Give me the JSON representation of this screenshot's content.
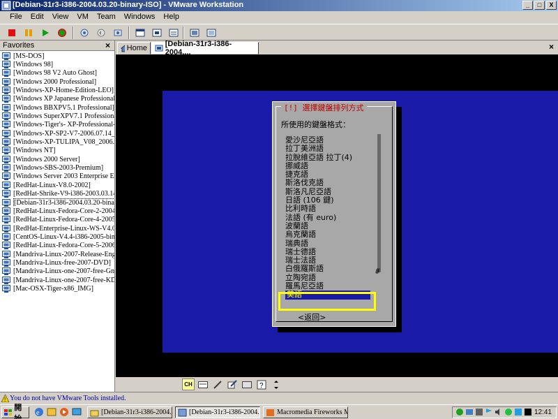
{
  "window": {
    "title": "[Debian-31r3-i386-2004.03.20-binary-ISO] - VMware Workstation",
    "buttons": [
      "_",
      "□",
      "X"
    ]
  },
  "menu": [
    {
      "label": "File",
      "accel": "F"
    },
    {
      "label": "Edit",
      "accel": "E"
    },
    {
      "label": "View",
      "accel": "V"
    },
    {
      "label": "VM",
      "accel": "M"
    },
    {
      "label": "Team",
      "accel": "T"
    },
    {
      "label": "Windows",
      "accel": "W"
    },
    {
      "label": "Help",
      "accel": "H"
    }
  ],
  "toolbar": {
    "icons": [
      "power-off-icon",
      "suspend-icon",
      "power-on-icon",
      "reset-icon",
      "snapshot-take-icon",
      "snapshot-revert-icon",
      "snapshot-manager-icon",
      "quick-switch-icon",
      "full-screen-icon",
      "summary-view-icon",
      "console-view-icon"
    ]
  },
  "favorites": {
    "header": "Favorites",
    "items": [
      "[MS-DOS]",
      "[Windows 98]",
      "[Windows 98 V2 Auto Ghost]",
      "[Windows 2000 Professional]",
      "[Windows-XP-Home-Edition-LEO]",
      "[Windows XP Japanese Professional]",
      "[Windows BBXPV5.1 Professional]",
      "[Windows SuperXPV7.1 Professional]",
      "[Windows-Tiger's- XP-Professional-20",
      "[Windows-XP-SP2-V7-2006.07.14_IS",
      "[Windows-XP-TULIPA_V08_2006.08",
      "[Windows NT]",
      "[Windows 2000 Server]",
      "[Windows-SBS-2003-Premium]",
      "[Windows Server 2003 Enterprise Edit",
      "[RedHat-Linux-V8.0-2002]",
      "[RedHat-Shrike-V9-i386-2003.03.14-c",
      "[Debian-31r3-i386-2004.03.20-binary",
      "[RedHat-Linux-Fedora-Core-2-2004]",
      "[RedHat-Linux-Fedora-Core-4-2005]",
      "[RedHat-Enterprise-Linux-WS-V4.0-2",
      "[CentOS-Linux-V4.4-i386-2005-bin1-",
      "[RedHat-Linux-Fedora-Core-5-2006-i",
      "[Mandriva-Linux-2007-Release-Eng-C",
      "[Mandriva-Linux-free-2007-DVD]",
      "[Mandriva-Linux-one-2007-free-Gnor",
      "[Mandriva-Linux-one-2007-free-KDE",
      "[Mac-OSX-Tiger-x86_IMG]"
    ],
    "selected_index": 17
  },
  "tabs": {
    "home": "Home",
    "active": "[Debian-31r3-i386-2004...."
  },
  "installer": {
    "title": "[!] 選擇鍵盤排列方式",
    "prompt": "所使用的鍵盤格式：",
    "items": [
      "愛沙尼亞語",
      "拉丁美洲語",
      "拉脫維亞語 拉丁(4)",
      "挪威語",
      "捷克語",
      "斯洛伐克語",
      "斯洛凡尼亞語",
      "日語 (106 鍵)",
      "比利時語",
      "法語 (有 euro)",
      "波蘭語",
      "烏克蘭語",
      "瑞典語",
      "瑞士德語",
      "瑞士法語",
      "白俄羅斯語",
      "立陶宛語",
      "羅馬尼亞語",
      "美語"
    ],
    "selected": "美語",
    "scroll_mark": "#",
    "back": "<返回>"
  },
  "vm_toolbar": {
    "ime_label": "CH"
  },
  "status": {
    "message": "You do not have VMware Tools installed."
  },
  "taskbar": {
    "start": "開始",
    "tasks": [
      {
        "label": "[Debian-31r3-i386-2004....",
        "active": false
      },
      {
        "label": "[Debian-31r3-i386-2004....",
        "active": true
      },
      {
        "label": "Macromedia Fireworks M...",
        "active": false
      }
    ],
    "clock": "12:41"
  },
  "colors": {
    "titlebar_start": "#0a246a",
    "installer_bg": "#1a1aa8",
    "dialog_bg": "#a8a8a8",
    "selection_fg": "#ffff00",
    "highlight_box": "#ffff00"
  }
}
